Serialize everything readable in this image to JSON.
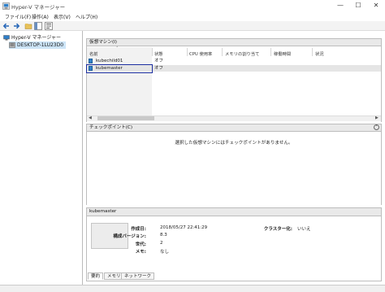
{
  "window": {
    "title": "Hyper-V マネージャー"
  },
  "menu": [
    "ファイル(F)",
    "操作(A)",
    "表示(V)",
    "ヘルプ(H)"
  ],
  "tree": {
    "root": "Hyper-V マネージャー",
    "server": "DESKTOP-1LU23D0"
  },
  "vm_panel": {
    "title": "仮想マシン(I)",
    "columns": [
      "名前",
      "状態",
      "CPU 使用率",
      "メモリの割り当て",
      "稼働時間",
      "状況"
    ],
    "rows": [
      {
        "name": "kubechild01",
        "state": "オフ"
      },
      {
        "name": "kubemaster",
        "state": "オフ"
      }
    ]
  },
  "checkpoint_panel": {
    "title": "チェックポイント(C)",
    "empty_message": "選択した仮想マシンにはチェックポイントがありません。"
  },
  "details": {
    "title": "kubemaster",
    "created_label": "作成日:",
    "created_value": "2018/05/27 22:41:29",
    "config_label": "構成バージョン:",
    "config_value": "8.3",
    "gen_label": "世代:",
    "gen_value": "2",
    "notes_label": "メモ:",
    "notes_value": "なし",
    "cluster_label": "クラスター化:",
    "cluster_value": "いいえ",
    "tabs": [
      "要約",
      "メモリ",
      "ネットワーク"
    ]
  },
  "colors": {
    "selection_border": "#1c2ea0",
    "tree_selection": "#cce4f7",
    "vm_icon": "#2f7fc9"
  }
}
